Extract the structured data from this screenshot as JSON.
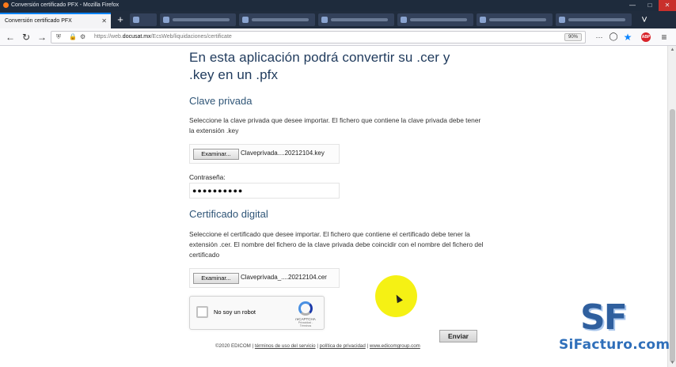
{
  "window": {
    "title": "Conversión certificado PFX - Mozilla Firefox"
  },
  "tabs": {
    "active_label": "Conversión certificado PFX",
    "new_tab_symbol": "+"
  },
  "navbar": {
    "url_prefix": "https://web.",
    "url_domain": "docusat.mx",
    "url_path": "/EcsWeb/liquidaciones/certificate",
    "zoom": "90%",
    "overflow_symbol": "···"
  },
  "page": {
    "heading": "En esta aplicación podrá convertir su .cer y .key en un .pfx",
    "private_key": {
      "title": "Clave privada",
      "description": "Seleccione la clave privada que desee importar. El fichero que contiene la clave privada debe tener la extensión .key",
      "browse_label": "Examinar...",
      "file_name": "Claveprivada....20212104.key"
    },
    "password": {
      "label": "Contraseña:",
      "masked_value": "●●●●●●●●●●"
    },
    "certificate": {
      "title": "Certificado digital",
      "description": "Seleccione el certificado que desee importar. El fichero que contiene el certificado debe tener la extensión .cer. El nombre del fichero de la clave privada debe coincidir con el nombre del fichero del certificado",
      "browse_label": "Examinar...",
      "file_name": "Claveprivada_....20212104.cer"
    },
    "captcha": {
      "label": "No soy un robot",
      "brand": "reCAPTCHA",
      "links": "Privacidad - Términos"
    },
    "submit_label": "Enviar",
    "footer": {
      "copyright": "©2020 EDICOM",
      "sep1": "|",
      "terms": "términos de uso del servicio",
      "sep2": "|",
      "privacy": "política de privacidad",
      "sep3": "|",
      "site": "www.edicomgroup.com"
    }
  },
  "watermark": {
    "mark": "SF",
    "text": "SiFacturo.com"
  },
  "colors": {
    "heading": "#1f3a5c",
    "subheading": "#2f5577",
    "titlebar": "#1e2b3c",
    "tab_accent": "#0a84ff",
    "cursor_highlight": "#f4f000",
    "watermark": "#2f6fba"
  }
}
